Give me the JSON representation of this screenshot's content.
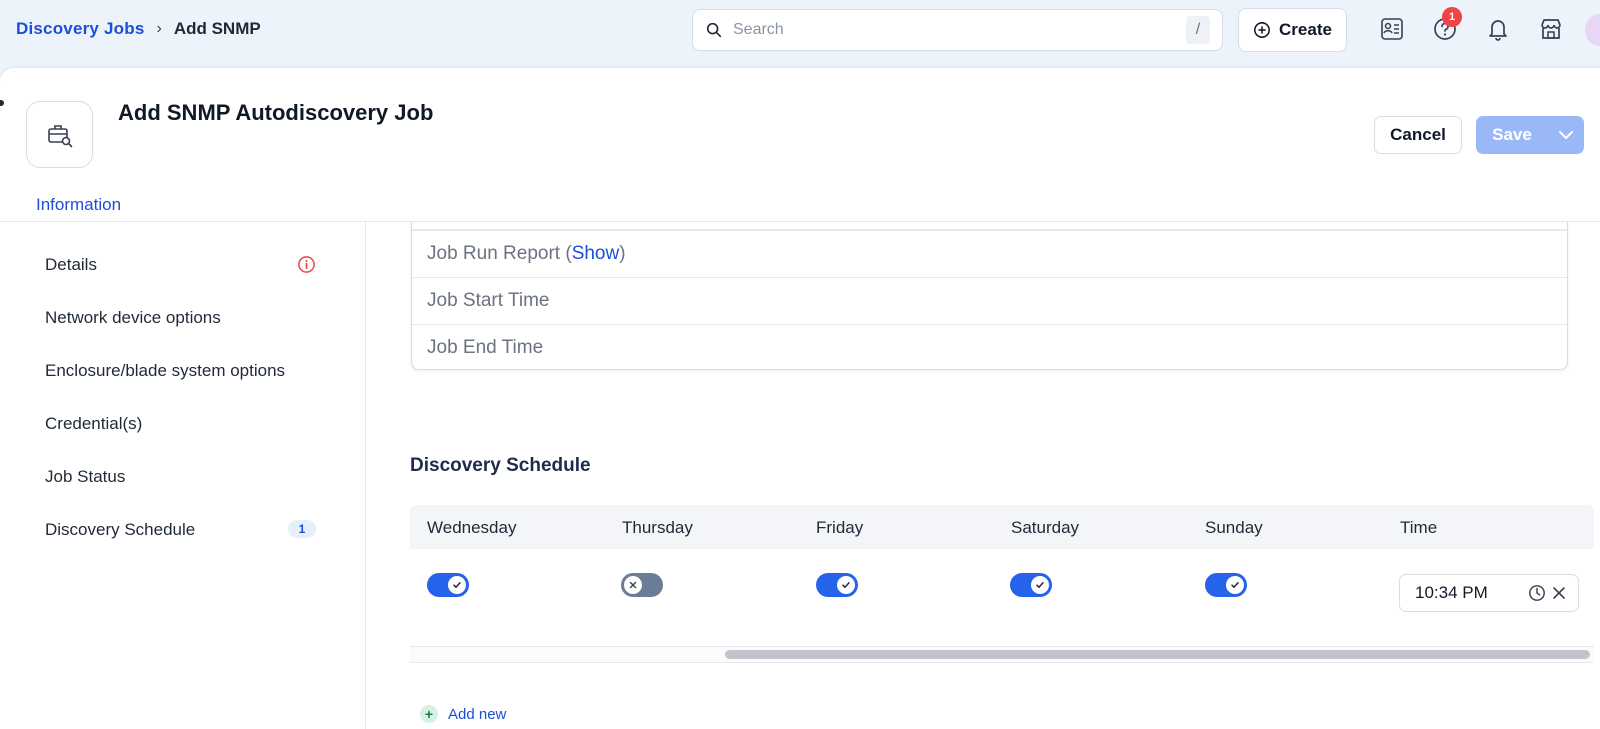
{
  "breadcrumb": {
    "parent": "Discovery Jobs",
    "separator": "›",
    "current": "Add SNMP"
  },
  "search": {
    "placeholder": "Search",
    "shortcut": "/"
  },
  "topbar": {
    "create_label": "Create",
    "help_badge": "1"
  },
  "header": {
    "title": "Add SNMP Autodiscovery Job",
    "cancel_label": "Cancel",
    "save_label": "Save"
  },
  "tabs": [
    {
      "label": "Information",
      "active": true
    }
  ],
  "nav": {
    "items": [
      {
        "label": "Details"
      },
      {
        "label": "Network device options"
      },
      {
        "label": "Enclosure/blade system options"
      },
      {
        "label": "Credential(s)"
      },
      {
        "label": "Job Status"
      },
      {
        "label": "Discovery Schedule",
        "count": "1"
      }
    ]
  },
  "job_status": {
    "report_label": "Job Run Report (",
    "report_link": "Show",
    "report_close": ")",
    "start_label": "Job Start Time",
    "end_label": "Job End Time"
  },
  "schedule": {
    "title": "Discovery Schedule",
    "columns": [
      "Wednesday",
      "Thursday",
      "Friday",
      "Saturday",
      "Sunday",
      "Time"
    ],
    "row": {
      "wednesday": true,
      "thursday": false,
      "friday": true,
      "saturday": true,
      "sunday": true,
      "time": "10:34 PM"
    },
    "add_label": "Add new"
  },
  "colors": {
    "accent": "#1d4ed8",
    "toggle_on": "#2563eb",
    "toggle_off": "#6b7c95",
    "save_disabled": "#9ab8f7",
    "error": "#ef4444"
  }
}
